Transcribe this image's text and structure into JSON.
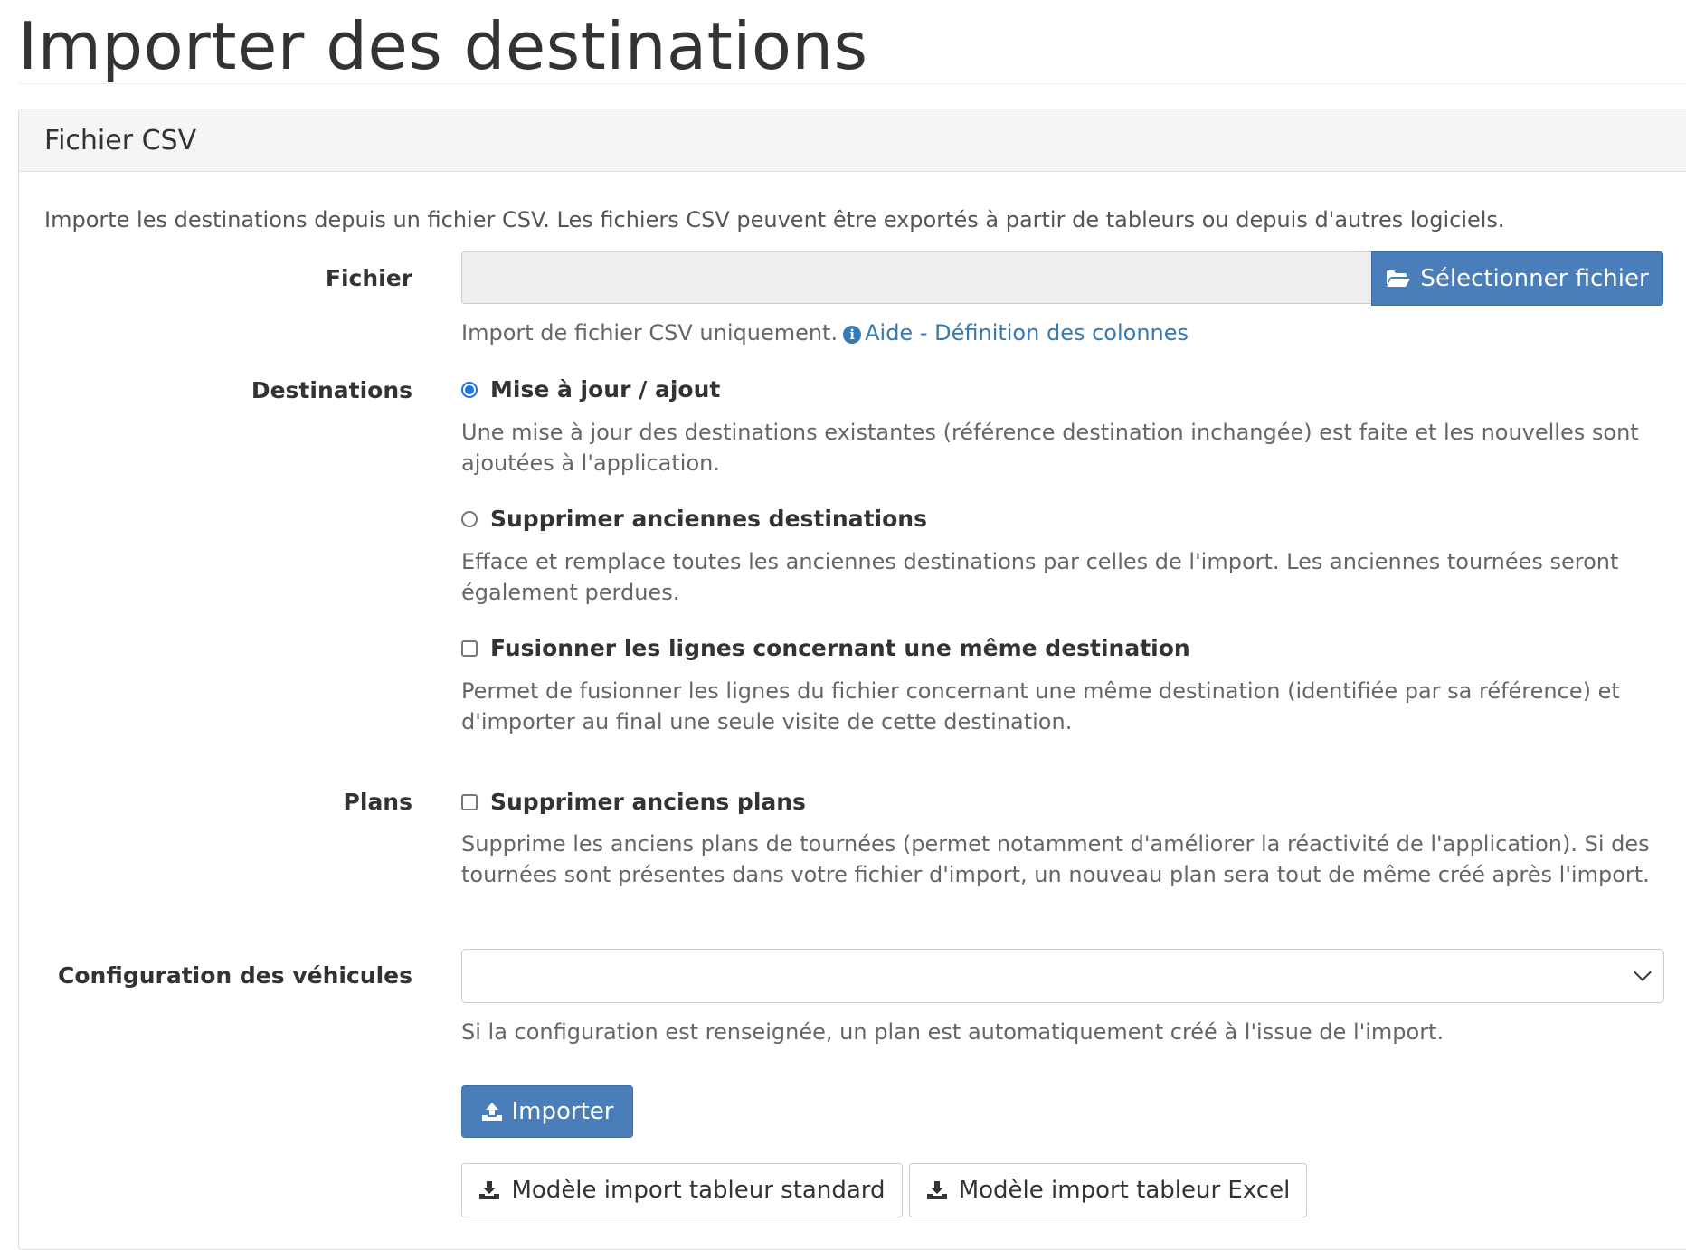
{
  "page": {
    "title": "Importer des destinations"
  },
  "panel": {
    "heading": "Fichier CSV",
    "intro": "Importe les destinations depuis un fichier CSV. Les fichiers CSV peuvent être exportés à partir de tableurs ou depuis d'autres logiciels."
  },
  "file": {
    "label": "Fichier",
    "value": "",
    "select_button": "Sélectionner fichier",
    "help_text": "Import de fichier CSV uniquement.",
    "help_link": "Aide - Définition des colonnes",
    "icons": {
      "select": "folder-open-icon",
      "help": "info-circle-icon"
    }
  },
  "destinations": {
    "label": "Destinations",
    "options": [
      {
        "type": "radio",
        "checked": true,
        "label": "Mise à jour / ajout",
        "help": "Une mise à jour des destinations existantes (référence destination inchangée) est faite et les nouvelles sont ajoutées à l'application."
      },
      {
        "type": "radio",
        "checked": false,
        "label": "Supprimer anciennes destinations",
        "help": "Efface et remplace toutes les anciennes destinations par celles de l'import. Les anciennes tournées seront également perdues."
      },
      {
        "type": "checkbox",
        "checked": false,
        "label": "Fusionner les lignes concernant une même destination",
        "help": "Permet de fusionner les lignes du fichier concernant une même destination (identifiée par sa référence) et d'importer au final une seule visite de cette destination."
      }
    ]
  },
  "plans": {
    "label": "Plans",
    "checkbox_checked": false,
    "checkbox_label": "Supprimer anciens plans",
    "help": "Supprime les anciens plans de tournées (permet notamment d'améliorer la réactivité de l'application). Si des tournées sont présentes dans votre fichier d'import, un nouveau plan sera tout de même créé après l'import."
  },
  "vehicles": {
    "label": "Configuration des véhicules",
    "selected": "",
    "help": "Si la configuration est renseignée, un plan est automatiquement créé à l'issue de l'import."
  },
  "actions": {
    "import": "Importer",
    "template_standard": "Modèle import tableur standard",
    "template_excel": "Modèle import tableur Excel",
    "icons": {
      "import": "upload-icon",
      "template": "download-icon"
    }
  },
  "colors": {
    "primary": "#4a7ebb",
    "link": "#337ab7",
    "radio_checked": "#1a73e8"
  }
}
